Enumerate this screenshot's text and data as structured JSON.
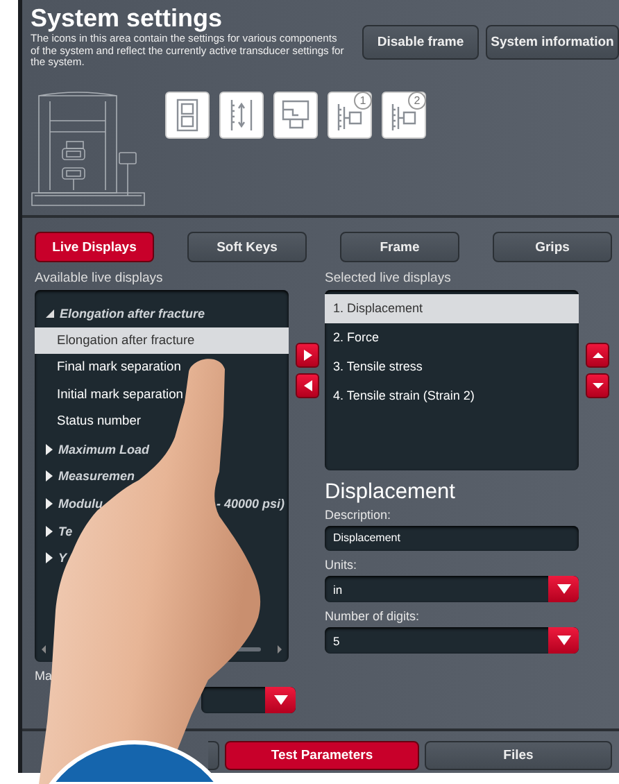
{
  "header": {
    "title": "System settings",
    "description": "The icons in this area contain the settings for various components of the system and reflect the currently active transducer settings for the system.",
    "buttons": [
      "Disable frame",
      "System information"
    ]
  },
  "components": [
    {
      "kind": "frame"
    },
    {
      "kind": "extensometer"
    },
    {
      "kind": "controller"
    },
    {
      "kind": "transducer",
      "badge": "1"
    },
    {
      "kind": "transducer",
      "badge": "2"
    }
  ],
  "tabs": [
    {
      "label": "Live Displays",
      "selected": true
    },
    {
      "label": "Soft Keys",
      "selected": false
    },
    {
      "label": "Frame",
      "selected": false
    },
    {
      "label": "Grips",
      "selected": false
    }
  ],
  "available": {
    "label": "Available live displays",
    "groups": [
      {
        "label": "Elongation after fracture",
        "expanded": true,
        "children": [
          {
            "label": "Elongation after fracture",
            "selected": true
          },
          {
            "label": "Final mark separation",
            "selected": false
          },
          {
            "label": "Initial mark separation",
            "selected": false
          },
          {
            "label": "Status number",
            "selected": false
          }
        ]
      },
      {
        "label": "Maximum Load",
        "expanded": false
      },
      {
        "label": "Measuremen",
        "expanded": false
      },
      {
        "label": "Modulu",
        "tail": "- 40000 psi)",
        "expanded": false
      },
      {
        "label": "Te",
        "expanded": false
      },
      {
        "label": "Y",
        "expanded": false
      }
    ]
  },
  "selected_list": {
    "label": "Selected live displays",
    "items": [
      {
        "label": "1. Displacement",
        "selected": true
      },
      {
        "label": "2. Force",
        "selected": false
      },
      {
        "label": "3. Tensile stress",
        "selected": false
      },
      {
        "label": "4. Tensile strain (Strain 2)",
        "selected": false
      }
    ]
  },
  "detail": {
    "title": "Displacement",
    "fields": [
      {
        "kind": "text",
        "label": "Description:",
        "value": "Displacement"
      },
      {
        "kind": "dropdown",
        "label": "Units:",
        "value": "in"
      },
      {
        "kind": "dropdown",
        "label": "Number of digits:",
        "value": "5"
      }
    ]
  },
  "lower_dropdown": {
    "label": "Ma"
  },
  "bottom_tabs": [
    {
      "selected": false
    },
    {
      "label": "Test Parameters",
      "selected": true
    },
    {
      "label": "Files",
      "selected": false
    }
  ]
}
